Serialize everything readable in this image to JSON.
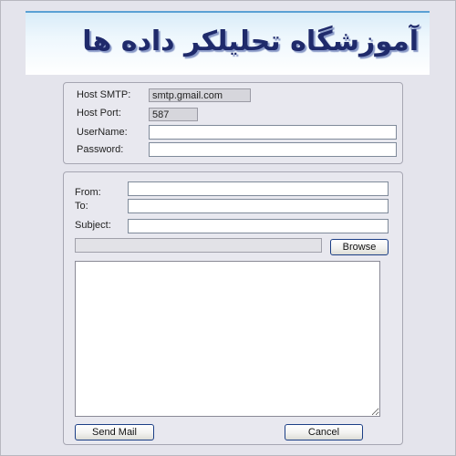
{
  "banner": {
    "title": "آموزشگاه تحلیلکر داده ها"
  },
  "smtp": {
    "host_label": "Host SMTP:",
    "host_value": "smtp.gmail.com",
    "port_label": "Host Port:",
    "port_value": "587",
    "username_label": "UserName:",
    "username_value": "",
    "password_label": "Password:",
    "password_value": ""
  },
  "mail": {
    "from_label": "From:",
    "from_value": "",
    "to_label": "To:",
    "to_value": "",
    "subject_label": "Subject:",
    "subject_value": "",
    "attachment_path": "",
    "browse_label": "Browse",
    "body_value": ""
  },
  "actions": {
    "send_label": "Send Mail",
    "cancel_label": "Cancel"
  }
}
